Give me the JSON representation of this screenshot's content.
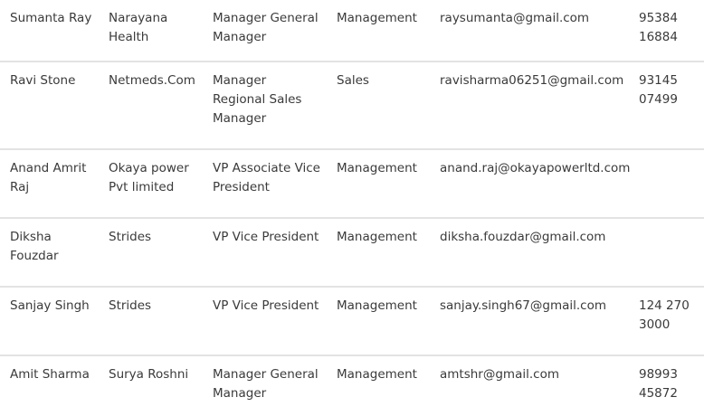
{
  "rows": [
    {
      "name": "Sumanta Ray",
      "company": "Narayana Health",
      "title": "Manager General Manager",
      "department": "Management",
      "email": "raysumanta@gmail.com",
      "phone": "95384 16884"
    },
    {
      "name": "Ravi Stone",
      "company": "Netmeds.Com",
      "title": "Manager Regional Sales Manager",
      "department": "Sales",
      "email": "ravisharma06251@gmail.com",
      "phone": "93145 07499"
    },
    {
      "name": "Anand Amrit Raj",
      "company": "Okaya power Pvt limited",
      "title": "VP Associate Vice President",
      "department": "Management",
      "email": "anand.raj@okayapowerltd.com",
      "phone": ""
    },
    {
      "name": "Diksha Fouzdar",
      "company": "Strides",
      "title": "VP Vice President",
      "department": "Management",
      "email": "diksha.fouzdar@gmail.com",
      "phone": ""
    },
    {
      "name": "Sanjay Singh",
      "company": "Strides",
      "title": "VP Vice President",
      "department": "Management",
      "email": "sanjay.singh67@gmail.com",
      "phone": "124 270 3000"
    },
    {
      "name": "Amit Sharma",
      "company": "Surya Roshni",
      "title": "Manager General Manager",
      "department": "Management",
      "email": "amtshr@gmail.com",
      "phone": "98993 45872"
    }
  ]
}
